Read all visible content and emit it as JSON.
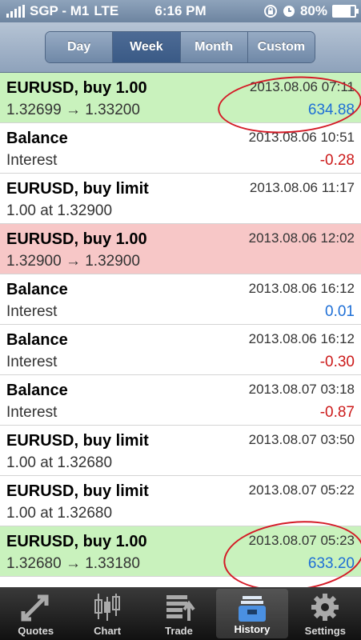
{
  "status": {
    "carrier": "SGP - M1",
    "network": "LTE",
    "time": "6:16 PM",
    "battery": "80%",
    "battery_level": 0.8
  },
  "segments": [
    {
      "label": "Day",
      "active": false
    },
    {
      "label": "Week",
      "active": true
    },
    {
      "label": "Month",
      "active": false
    },
    {
      "label": "Custom",
      "active": false
    }
  ],
  "rows": [
    {
      "title": "EURUSD, buy 1.00",
      "sub": "1.32699 → 1.33200",
      "date": "2013.08.06 07:11",
      "amount": "634.88",
      "bg": "green",
      "amount_color": "pos"
    },
    {
      "title": "Balance",
      "sub": "Interest",
      "date": "2013.08.06 10:51",
      "amount": "-0.28",
      "bg": "white",
      "amount_color": "neg"
    },
    {
      "title": "EURUSD, buy limit",
      "sub": "1.00 at 1.32900",
      "date": "2013.08.06 11:17",
      "amount": "",
      "bg": "white",
      "amount_color": "pos"
    },
    {
      "title": "EURUSD, buy 1.00",
      "sub": "1.32900 → 1.32900",
      "date": "2013.08.06 12:02",
      "amount": "",
      "bg": "red",
      "amount_color": "pos"
    },
    {
      "title": "Balance",
      "sub": "Interest",
      "date": "2013.08.06 16:12",
      "amount": "0.01",
      "bg": "white",
      "amount_color": "pos"
    },
    {
      "title": "Balance",
      "sub": "Interest",
      "date": "2013.08.06 16:12",
      "amount": "-0.30",
      "bg": "white",
      "amount_color": "neg"
    },
    {
      "title": "Balance",
      "sub": "Interest",
      "date": "2013.08.07 03:18",
      "amount": "-0.87",
      "bg": "white",
      "amount_color": "neg"
    },
    {
      "title": "EURUSD, buy limit",
      "sub": "1.00 at 1.32680",
      "date": "2013.08.07 03:50",
      "amount": "",
      "bg": "white",
      "amount_color": "pos"
    },
    {
      "title": "EURUSD, buy limit",
      "sub": "1.00 at 1.32680",
      "date": "2013.08.07 05:22",
      "amount": "",
      "bg": "white",
      "amount_color": "pos"
    },
    {
      "title": "EURUSD, buy 1.00",
      "sub": "1.32680 → 1.33180",
      "date": "2013.08.07 05:23",
      "amount": "633.20",
      "bg": "green",
      "amount_color": "pos"
    }
  ],
  "tabs": [
    {
      "label": "Quotes",
      "icon": "quotes-arrows-icon",
      "active": false
    },
    {
      "label": "Chart",
      "icon": "candlestick-chart-icon",
      "active": false
    },
    {
      "label": "Trade",
      "icon": "trade-list-icon",
      "active": false
    },
    {
      "label": "History",
      "icon": "history-tray-icon",
      "active": true
    },
    {
      "label": "Settings",
      "icon": "gear-icon",
      "active": false
    }
  ],
  "colors": {
    "profit_row": "#c9f2bd",
    "loss_row": "#f7c7c7",
    "positive": "#1e6fd6",
    "negative": "#cc1a1a",
    "annotation": "#d41a26"
  }
}
